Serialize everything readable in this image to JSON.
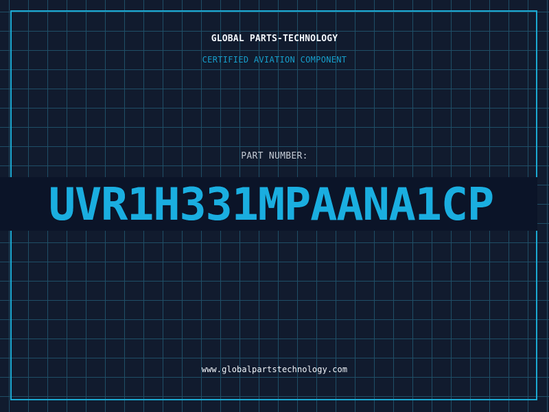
{
  "header": {
    "company": "GLOBAL PARTS-TECHNOLOGY",
    "tagline": "CERTIFIED AVIATION COMPONENT"
  },
  "part": {
    "label": "PART NUMBER:",
    "number": "UVR1H331MPAANA1CP"
  },
  "footer": {
    "website": "www.globalpartstechnology.com"
  },
  "colors": {
    "background": "#111b2e",
    "grid": "#1f4f67",
    "accent": "#1ba9d2",
    "text": "#f2f6fb"
  }
}
